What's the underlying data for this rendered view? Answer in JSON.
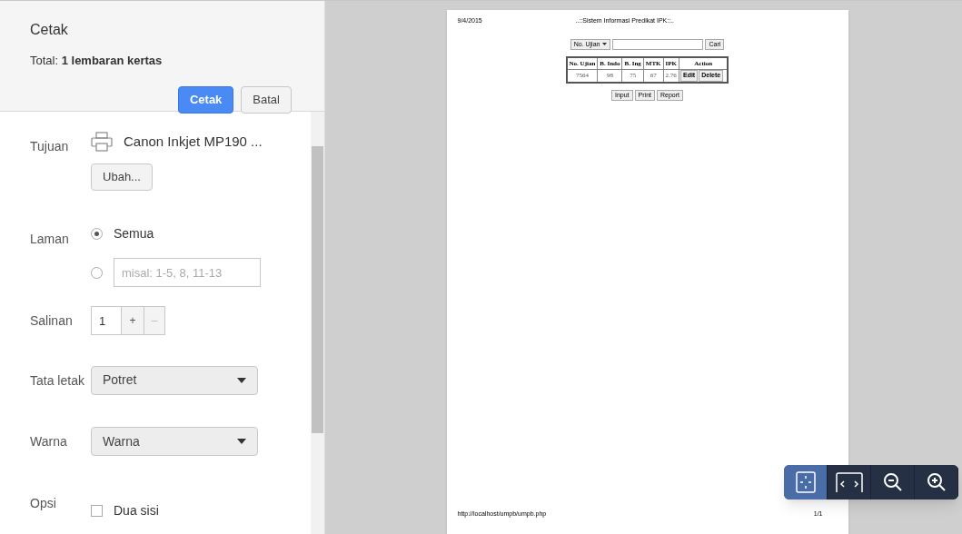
{
  "header": {
    "title": "Cetak",
    "total": "Total: **1 lembaran kertas**",
    "buttons": [
      {
        "label": "Cetak",
        "kind": "primary"
      },
      {
        "label": "Batal",
        "kind": "secondary"
      }
    ]
  },
  "settings": [
    {
      "kind": "destination",
      "label": "Tujuan",
      "printer": "Canon Inkjet MP190 ...",
      "button": "Ubah..."
    },
    {
      "kind": "pages",
      "label": "Laman",
      "options": [
        {
          "label": "Semua",
          "selected": true
        },
        {
          "placeholder": "misal: 1-5, 8, 11-13",
          "selected": false
        }
      ]
    },
    {
      "kind": "copies",
      "label": "Salinan",
      "value": "1",
      "plus": "+",
      "minus": "–"
    },
    {
      "kind": "select",
      "label": "Tata letak",
      "value": "Potret"
    },
    {
      "kind": "select",
      "label": "Warna",
      "value": "Warna"
    },
    {
      "kind": "checkbox",
      "label": "Opsi",
      "option": "Dua sisi",
      "checked": false
    }
  ],
  "preview": {
    "date": "9/4/2015",
    "title": "..::Sistem Informasi Predikat IPK::..",
    "search_select": "No. Ujian",
    "search_button": "Cari",
    "columns": [
      "No. Ujian",
      "B. Indo",
      "B. Ing",
      "MTK",
      "IPK",
      "Action"
    ],
    "rows": [
      {
        "cells": [
          "7564",
          "98",
          "75",
          "67",
          "2.76"
        ],
        "actions": [
          "Edit",
          "Delete"
        ]
      }
    ],
    "buttons": [
      "Input",
      "Print",
      "Report"
    ],
    "footer_url": "http://localhost/umpb/umpb.php",
    "page_number": "1/1"
  },
  "zoom_toolbar": [
    {
      "kind": "fit",
      "selected": true
    },
    {
      "kind": "page",
      "selected": false
    },
    {
      "kind": "zoom_out",
      "selected": false
    },
    {
      "kind": "zoom_in",
      "selected": false
    }
  ]
}
